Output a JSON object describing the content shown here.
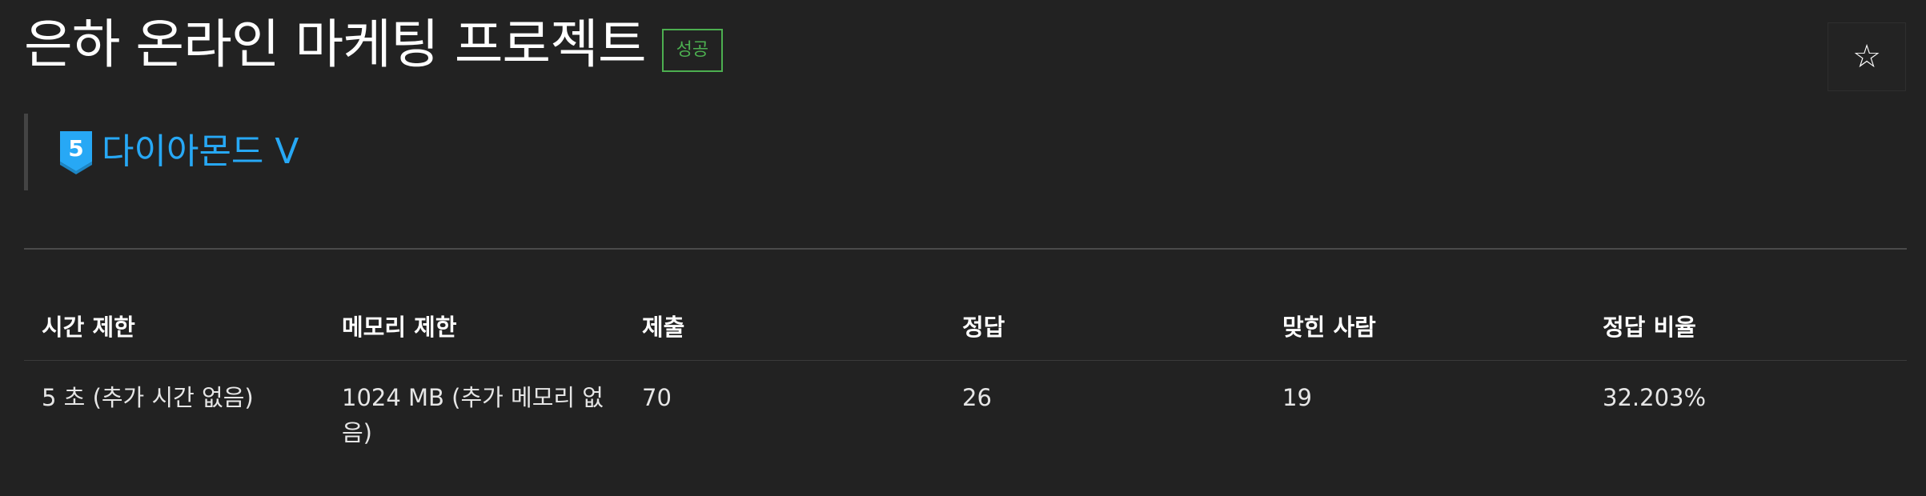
{
  "problem": {
    "title": "은하 온라인 마케팅 프로젝트",
    "result_badge": "성공",
    "star_icon": "☆",
    "tier": {
      "label": "다이아몬드 V",
      "icon_number": "5",
      "color": "#27a8f5"
    }
  },
  "info_table": {
    "headers": [
      "시간 제한",
      "메모리 제한",
      "제출",
      "정답",
      "맞힌 사람",
      "정답 비율"
    ],
    "row": [
      "5 초 (추가 시간 없음)",
      "1024 MB (추가 메모리 없음)",
      "70",
      "26",
      "19",
      "32.203%"
    ]
  },
  "colors": {
    "background": "#222222",
    "success": "#4caf50",
    "tier_diamond": "#27a8f5"
  }
}
